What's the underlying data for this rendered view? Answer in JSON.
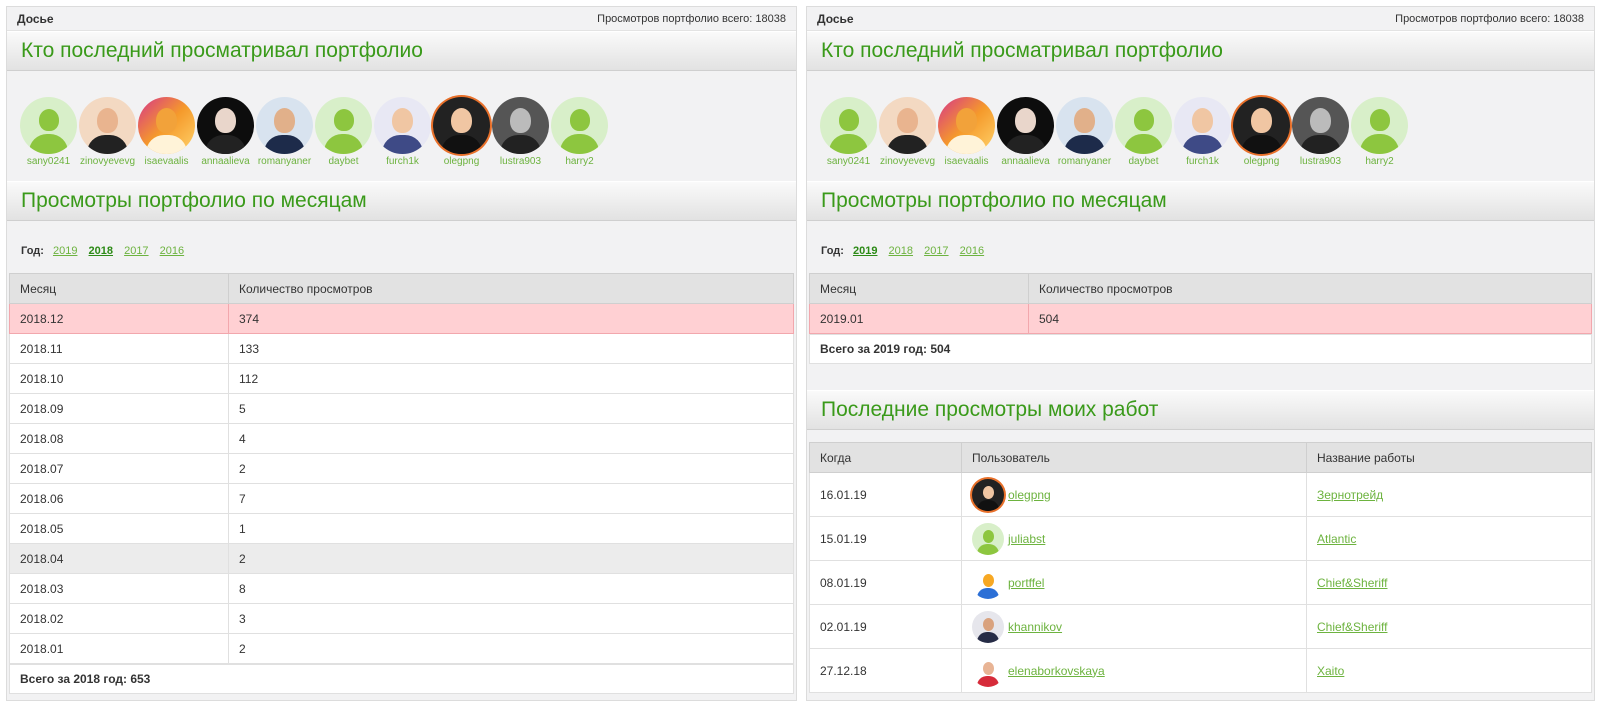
{
  "left": {
    "topbar": {
      "title": "Досье",
      "views_total": "Просмотров портфолио всего: 18038"
    },
    "viewers_title": "Кто последний просматривал портфолио",
    "viewers": [
      {
        "name": "sany0241",
        "avatar": "default"
      },
      {
        "name": "zinovyevevg",
        "avatar": "photo-man-dark"
      },
      {
        "name": "isaevaalis",
        "avatar": "photo-fox"
      },
      {
        "name": "annaalieva",
        "avatar": "photo-dark-hair"
      },
      {
        "name": "romanyaner",
        "avatar": "photo-man-sky"
      },
      {
        "name": "daybet",
        "avatar": "default"
      },
      {
        "name": "furch1k",
        "avatar": "photo-man-light"
      },
      {
        "name": "olegpng",
        "avatar": "photo-designer"
      },
      {
        "name": "lustra903",
        "avatar": "photo-bw"
      },
      {
        "name": "harry2",
        "avatar": "default"
      }
    ],
    "months_title": "Просмотры портфолио по месяцам",
    "year_label": "Год:",
    "years": [
      "2019",
      "2018",
      "2017",
      "2016"
    ],
    "active_year": "2018",
    "table": {
      "headers": [
        "Месяц",
        "Количество просмотров"
      ],
      "rows": [
        [
          "2018.12",
          "374"
        ],
        [
          "2018.11",
          "133"
        ],
        [
          "2018.10",
          "112"
        ],
        [
          "2018.09",
          "5"
        ],
        [
          "2018.08",
          "4"
        ],
        [
          "2018.07",
          "2"
        ],
        [
          "2018.06",
          "7"
        ],
        [
          "2018.05",
          "1"
        ],
        [
          "2018.04",
          "2"
        ],
        [
          "2018.03",
          "8"
        ],
        [
          "2018.02",
          "3"
        ],
        [
          "2018.01",
          "2"
        ]
      ]
    },
    "total": "Всего за 2018 год: 653"
  },
  "right": {
    "topbar": {
      "title": "Досье",
      "views_total": "Просмотров портфолио всего: 18038"
    },
    "viewers_title": "Кто последний просматривал портфолио",
    "viewers": [
      {
        "name": "sany0241",
        "avatar": "default"
      },
      {
        "name": "zinovyevevg",
        "avatar": "photo-man-dark"
      },
      {
        "name": "isaevaalis",
        "avatar": "photo-fox"
      },
      {
        "name": "annaalieva",
        "avatar": "photo-dark-hair"
      },
      {
        "name": "romanyaner",
        "avatar": "photo-man-sky"
      },
      {
        "name": "daybet",
        "avatar": "default"
      },
      {
        "name": "furch1k",
        "avatar": "photo-man-light"
      },
      {
        "name": "olegpng",
        "avatar": "photo-designer"
      },
      {
        "name": "lustra903",
        "avatar": "photo-bw"
      },
      {
        "name": "harry2",
        "avatar": "default"
      }
    ],
    "months_title": "Просмотры портфолио по месяцам",
    "year_label": "Год:",
    "years": [
      "2019",
      "2018",
      "2017",
      "2016"
    ],
    "active_year": "2019",
    "table": {
      "headers": [
        "Месяц",
        "Количество просмотров"
      ],
      "rows": [
        [
          "2019.01",
          "504"
        ]
      ]
    },
    "total": "Всего за 2019 год: 504",
    "recent_title": "Последние просмотры моих работ",
    "recent": {
      "headers": [
        "Когда",
        "Пользователь",
        "Название работы"
      ],
      "rows": [
        {
          "date": "16.01.19",
          "user": "olegpng",
          "avatar": "photo-designer",
          "work": "Зернотрейд"
        },
        {
          "date": "15.01.19",
          "user": "juliabst",
          "avatar": "default",
          "work": "Atlantic"
        },
        {
          "date": "08.01.19",
          "user": "portffel",
          "avatar": "logo-portffel",
          "work": "Chief&Sheriff"
        },
        {
          "date": "02.01.19",
          "user": "khannikov",
          "avatar": "photo-man-suit",
          "work": "Chief&Sheriff"
        },
        {
          "date": "27.12.18",
          "user": "elenaborkovskaya",
          "avatar": "photo-woman-red",
          "work": "Xaito"
        }
      ]
    }
  },
  "colors": {
    "accent_green": "#3a9a1a",
    "link_green": "#6db33f",
    "highlight_row": "#ffd0d3",
    "avatar_ring": "#e8702a"
  }
}
